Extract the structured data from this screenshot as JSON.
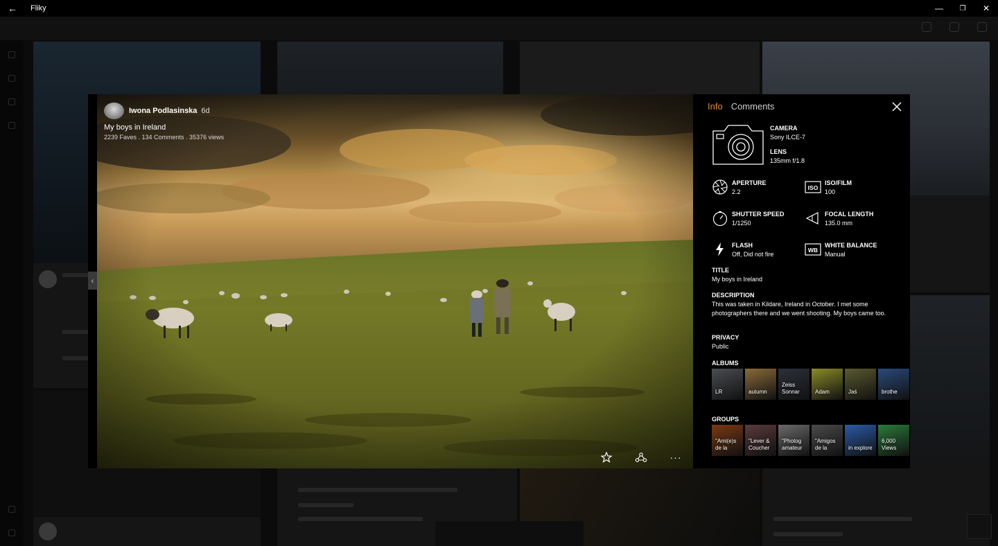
{
  "app": {
    "title": "Fliky"
  },
  "window": {
    "back": "←",
    "minimize": "—",
    "restore": "❐",
    "close": "✕"
  },
  "photo": {
    "author": "Iwona Podlasinska",
    "age": "6d",
    "caption": "My boys in Ireland",
    "stats": "2239 Faves . 134 Comments . 35376 views"
  },
  "actions": {
    "more": "···"
  },
  "nav": {
    "prev": "‹",
    "next": "›"
  },
  "tabs": {
    "info": "Info",
    "comments": "Comments"
  },
  "exif": {
    "camera_label": "CAMERA",
    "camera_value": "Sony ILCE-7",
    "lens_label": "LENS",
    "lens_value": "135mm f/1.8",
    "aperture_label": "APERTURE",
    "aperture_value": "2.2",
    "iso_label": "ISO/FILM",
    "iso_value": "100",
    "iso_icon_text": "ISO",
    "shutter_label": "SHUTTER SPEED",
    "shutter_value": "1/1250",
    "focal_label": "FOCAL LENGTH",
    "focal_value": "135.0 mm",
    "flash_label": "FLASH",
    "flash_value": "Off, Did not fire",
    "wb_label": "WHITE BALANCE",
    "wb_value": "Manual",
    "wb_icon_text": "WB"
  },
  "meta": {
    "title_label": "TITLE",
    "title_value": "My boys in Ireland",
    "description_label": "DESCRIPTION",
    "description_value": "This was taken in Kildare, Ireland in October. I met some photographers there and we went shooting. My boys came too.",
    "privacy_label": "PRIVACY",
    "privacy_value": "Public",
    "albums_label": "ALBUMS",
    "groups_label": "GROUPS"
  },
  "albums": [
    {
      "name": "LR",
      "color": "#4a4d52"
    },
    {
      "name": "autumn",
      "color": "#8a6a3a"
    },
    {
      "name": "Zeiss Sonnar",
      "color": "#2c3138"
    },
    {
      "name": "Adam",
      "color": "#8a8a28"
    },
    {
      "name": "Jaś",
      "color": "#5a5a30"
    },
    {
      "name": "brothe",
      "color": "#2a4a7a"
    }
  ],
  "groups": [
    {
      "name": "\"Ami(e)s de la",
      "color": "#7a3a12"
    },
    {
      "name": "\"Lever & Coucher",
      "color": "#5a3a3a"
    },
    {
      "name": "\"Photog amateur",
      "color": "#6a6a6a"
    },
    {
      "name": "\"Amigos de la",
      "color": "#4a4a4a"
    },
    {
      "name": "in explore",
      "color": "#2a5aa8"
    },
    {
      "name": "6,000 Views",
      "color": "#2a7a3a"
    }
  ]
}
